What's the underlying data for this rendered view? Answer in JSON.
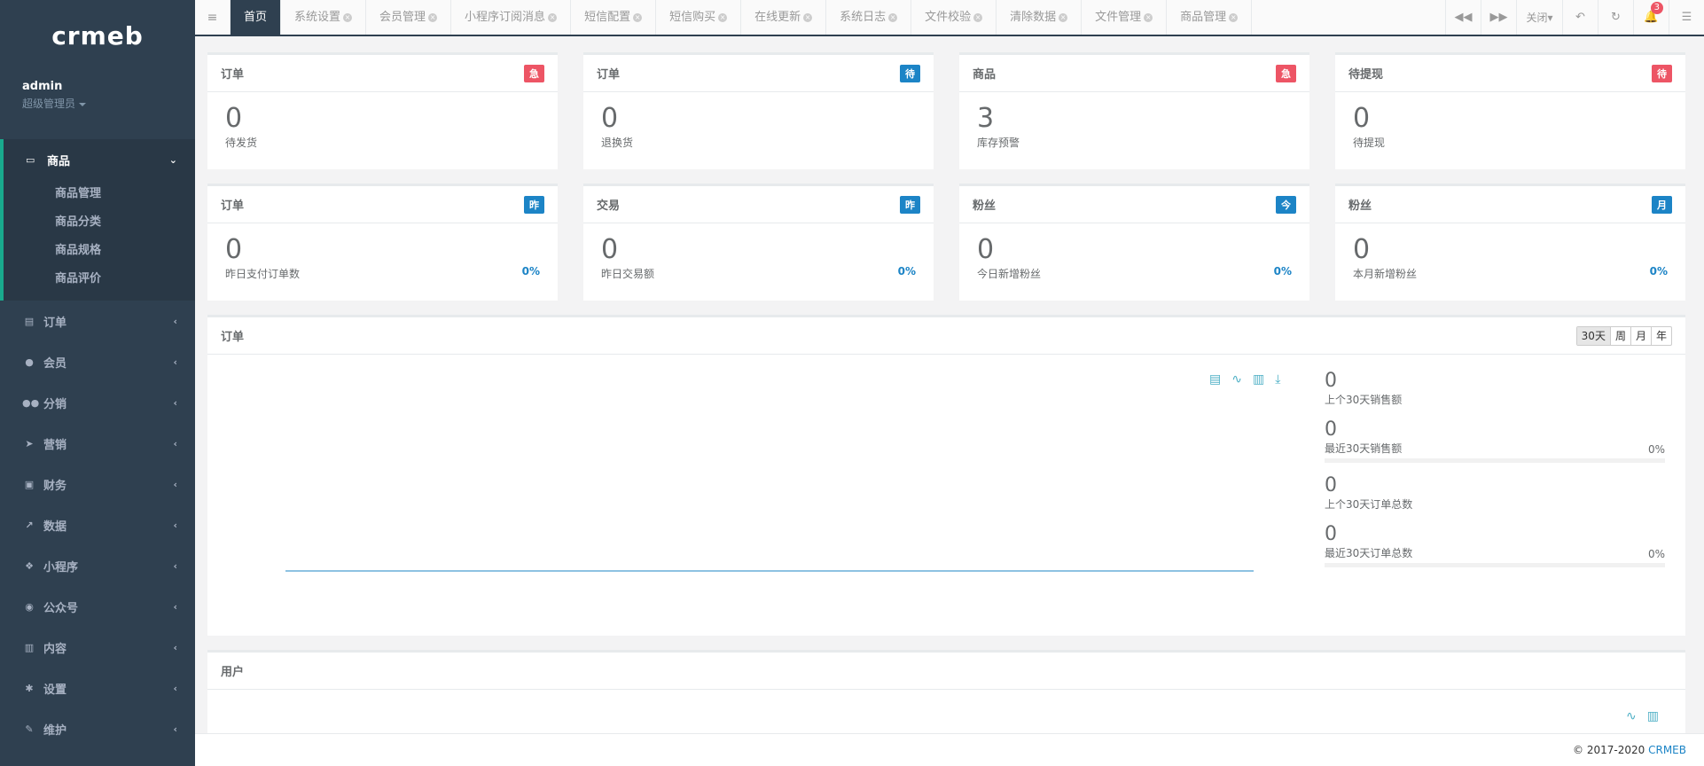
{
  "app": {
    "logo": "crmeb"
  },
  "profile": {
    "name": "admin",
    "role": "超级管理员"
  },
  "sidebar": {
    "active": {
      "label": "商品",
      "icon": "laptop-icon",
      "sub": [
        "商品管理",
        "商品分类",
        "商品规格",
        "商品评价"
      ]
    },
    "items": [
      {
        "label": "订单",
        "icon": "file-icon"
      },
      {
        "label": "会员",
        "icon": "user-icon"
      },
      {
        "label": "分销",
        "icon": "users-icon"
      },
      {
        "label": "营销",
        "icon": "paper-plane-icon"
      },
      {
        "label": "财务",
        "icon": "money-icon"
      },
      {
        "label": "数据",
        "icon": "line-chart-icon"
      },
      {
        "label": "小程序",
        "icon": "cubes-icon"
      },
      {
        "label": "公众号",
        "icon": "wechat-icon"
      },
      {
        "label": "内容",
        "icon": "book-icon"
      },
      {
        "label": "设置",
        "icon": "cog-icon"
      },
      {
        "label": "维护",
        "icon": "magic-icon"
      }
    ]
  },
  "tabs": [
    "首页",
    "系统设置",
    "会员管理",
    "小程序订阅消息",
    "短信配置",
    "短信购买",
    "在线更新",
    "系统日志",
    "文件校验",
    "清除数据",
    "文件管理",
    "商品管理"
  ],
  "toolbar": {
    "close_label": "关闭",
    "notification_count": "3"
  },
  "cards_row1": [
    {
      "title": "订单",
      "badge": "急",
      "badge_color": "#ed5565",
      "value": "0",
      "desc": "待发货"
    },
    {
      "title": "订单",
      "badge": "待",
      "badge_color": "#1c84c6",
      "value": "0",
      "desc": "退换货"
    },
    {
      "title": "商品",
      "badge": "急",
      "badge_color": "#ed5565",
      "value": "3",
      "desc": "库存预警"
    },
    {
      "title": "待提现",
      "badge": "待",
      "badge_color": "#ed5565",
      "value": "0",
      "desc": "待提现"
    }
  ],
  "cards_row2": [
    {
      "title": "订单",
      "badge": "昨",
      "value": "0",
      "desc": "昨日支付订单数",
      "pct": "0%"
    },
    {
      "title": "交易",
      "badge": "昨",
      "value": "0",
      "desc": "昨日交易额",
      "pct": "0%"
    },
    {
      "title": "粉丝",
      "badge": "今",
      "value": "0",
      "desc": "今日新增粉丝",
      "pct": "0%"
    },
    {
      "title": "粉丝",
      "badge": "月",
      "value": "0",
      "desc": "本月新增粉丝",
      "pct": "0%"
    }
  ],
  "order_panel": {
    "title": "订单",
    "ranges": [
      "30天",
      "周",
      "月",
      "年"
    ],
    "stats": [
      {
        "value": "0",
        "desc": "上个30天销售额",
        "pct": ""
      },
      {
        "value": "0",
        "desc": "最近30天销售额",
        "pct": "0%"
      },
      {
        "value": "0",
        "desc": "上个30天订单总数",
        "pct": ""
      },
      {
        "value": "0",
        "desc": "最近30天订单总数",
        "pct": "0%"
      }
    ]
  },
  "user_panel": {
    "title": "用户"
  },
  "footer": {
    "copyright": "© 2017-2020",
    "brand": "CRMEB"
  }
}
